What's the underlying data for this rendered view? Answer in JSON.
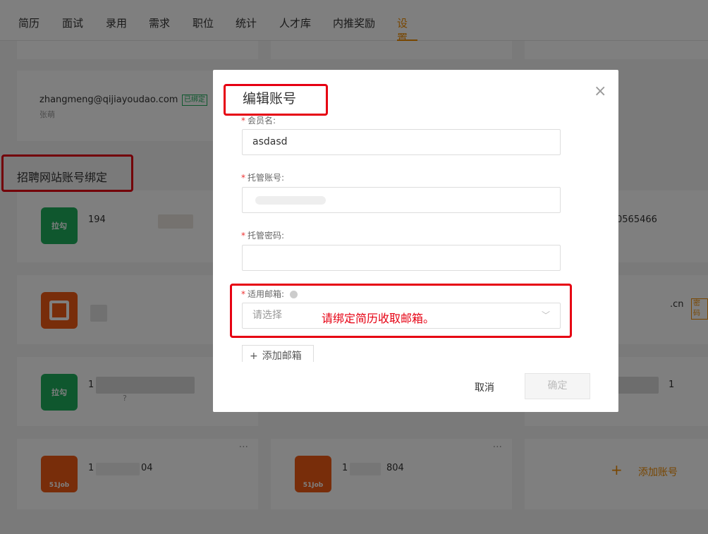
{
  "nav": {
    "items": [
      "简历",
      "面试",
      "录用",
      "需求",
      "职位",
      "统计",
      "人才库",
      "内推奖励",
      "设置"
    ],
    "active": "设置"
  },
  "bound_email": {
    "email": "zhangmeng@qijiayoudao.com",
    "badge": "已绑定",
    "name": "张萌"
  },
  "section_title": "招聘网站账号绑定",
  "accounts": {
    "row1_left_num": "194",
    "row1_right_num": "0565466",
    "row2_right_suffix": ".cn",
    "row2_right_badge": "密码",
    "row3_left_num": "1",
    "row3_left_q": "?",
    "row3_right_num": "1",
    "row4_left_num_a": "1",
    "row4_left_num_b": "04",
    "row4_mid_num_a": "1",
    "row4_mid_num_b": "804",
    "more_dots": "···",
    "logo_lagou": "拉勾",
    "logo_51job": "51Job"
  },
  "add_account": {
    "plus": "+",
    "label": "添加账号"
  },
  "modal": {
    "title": "编辑账号",
    "close": "×",
    "fields": {
      "member_label": "会员名:",
      "member_value": "asdasd",
      "hosted_account_label": "托管账号:",
      "hosted_password_label": "托管密码:",
      "email_label": "适用邮箱:",
      "email_placeholder": "请选择"
    },
    "required_mark": "*",
    "hint": "请绑定简历收取邮箱。",
    "add_email": "添加邮箱",
    "cancel": "取消",
    "confirm": "确定"
  },
  "colors": {
    "accent": "#f08c00",
    "annotation_red": "#e60012",
    "lagou_green": "#1fae5d",
    "job51_orange": "#f05a14"
  }
}
